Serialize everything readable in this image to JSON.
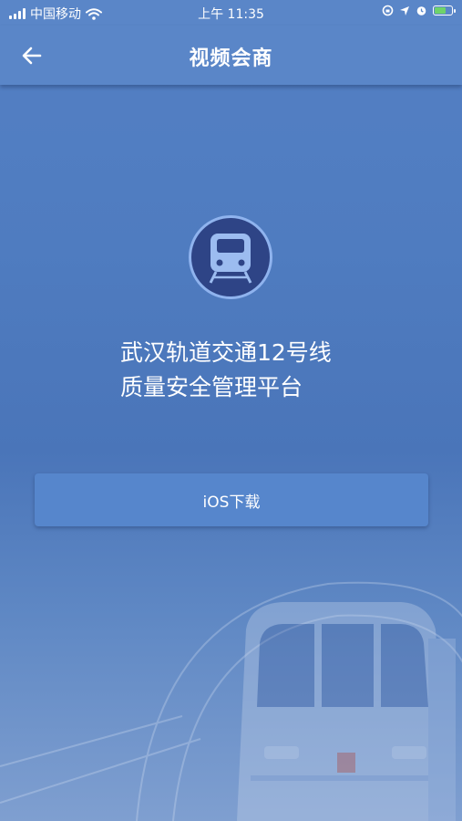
{
  "status_bar": {
    "carrier": "中国移动",
    "time": "上午 11:35",
    "battery_level_percent": 70,
    "icons": [
      "signal-icon",
      "wifi-icon",
      "rotation-lock-icon",
      "location-icon",
      "alarm-icon",
      "battery-icon"
    ]
  },
  "nav": {
    "back_icon": "back-arrow-icon",
    "title": "视频会商"
  },
  "main": {
    "logo_icon": "train-icon",
    "title_line1": "武汉轨道交通12号线",
    "title_line2": "质量安全管理平台",
    "download_button": "iOS下载"
  },
  "background": {
    "image": "subway-train-illustration"
  },
  "colors": {
    "primary": "#5a86c8",
    "button": "#5686cc",
    "logo_bg": "#2e4486",
    "logo_ring": "#8fb3ee",
    "icon_light": "#9cbcf0"
  }
}
